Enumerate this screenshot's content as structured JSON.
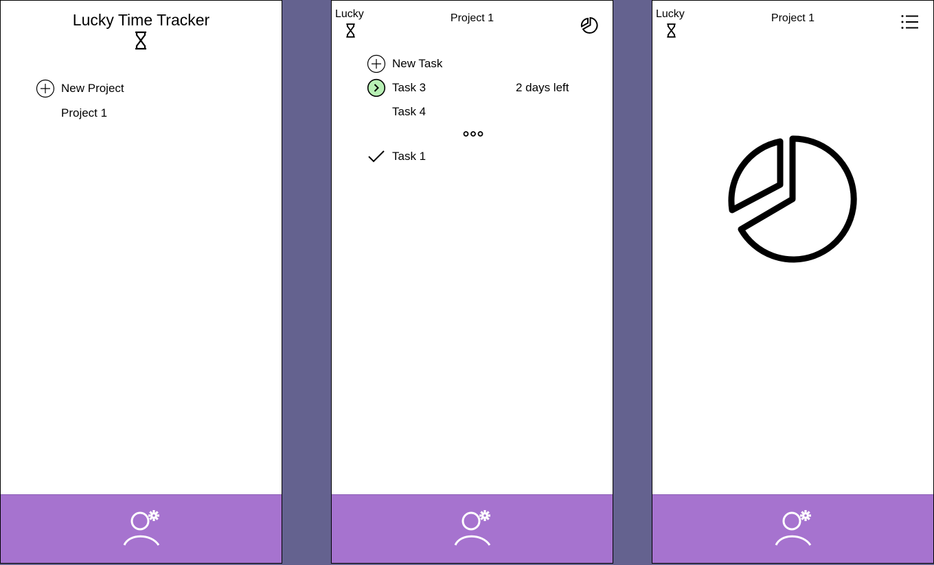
{
  "home": {
    "app_title": "Lucky Time Tracker",
    "new_project_label": "New Project",
    "projects": [
      "Project 1"
    ]
  },
  "tasks_view": {
    "brand": "Lucky",
    "title": "Project 1",
    "new_task_label": "New Task",
    "active_tasks": [
      {
        "name": "Task 3",
        "status": "2 days left",
        "active": true
      },
      {
        "name": "Task 4",
        "status": "",
        "active": false
      }
    ],
    "completed_tasks": [
      {
        "name": "Task 1"
      }
    ]
  },
  "stats_view": {
    "brand": "Lucky",
    "title": "Project 1"
  },
  "icons": {
    "hourglass": "hourglass-icon",
    "add": "add-circle-icon",
    "play": "play-circle-icon",
    "check": "check-icon",
    "more": "more-dots-icon",
    "pie": "pie-chart-icon",
    "list": "list-icon",
    "user_settings": "user-settings-icon"
  },
  "colors": {
    "background": "#64628f",
    "footer": "#a673cf",
    "active_task": "#b8f0b5"
  }
}
